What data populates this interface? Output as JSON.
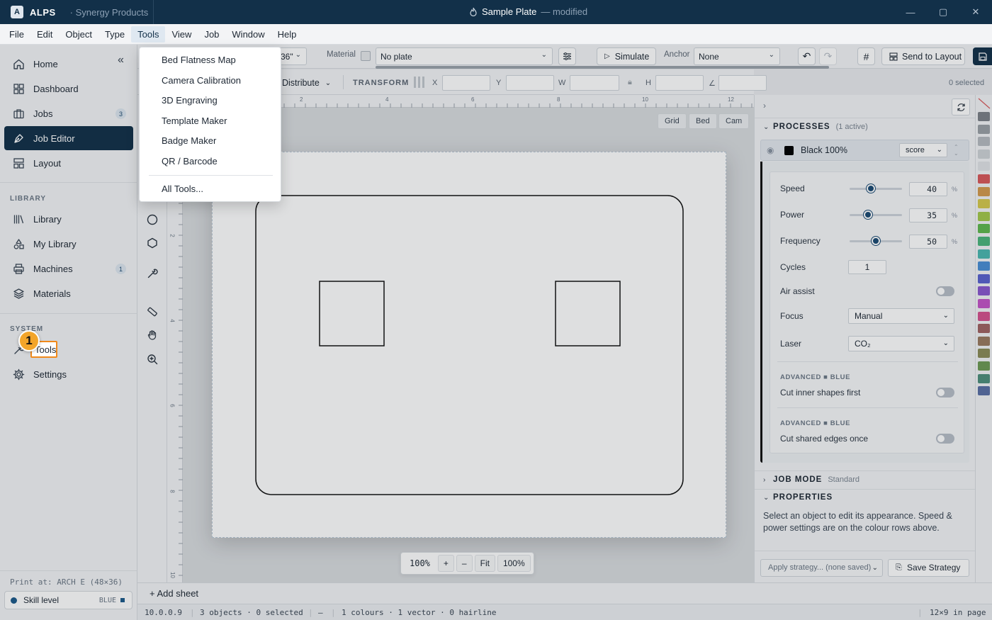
{
  "titlebar": {
    "logo_letter": "A",
    "app_name": "ALPS",
    "org": "· Synergy Products",
    "doc_title": "Sample Plate",
    "doc_status": "— modified"
  },
  "menubar": [
    "File",
    "Edit",
    "Object",
    "Type",
    "Tools",
    "View",
    "Job",
    "Window",
    "Help"
  ],
  "sidebar": {
    "nav": [
      {
        "label": "Home"
      },
      {
        "label": "Dashboard"
      },
      {
        "label": "Jobs",
        "badge": "3"
      },
      {
        "label": "Job Editor"
      },
      {
        "label": "Layout"
      }
    ],
    "library_heading": "LIBRARY",
    "library": [
      {
        "label": "Library"
      },
      {
        "label": "My Library"
      },
      {
        "label": "Machines",
        "badge": "1"
      },
      {
        "label": "Materials"
      }
    ],
    "system_heading": "SYSTEM",
    "system": [
      {
        "label": "Tools"
      },
      {
        "label": "Settings"
      }
    ],
    "print_at": "Print at: ARCH E (48×36)",
    "skill_label": "Skill level",
    "skill_value": "BLUE"
  },
  "toolbar": {
    "size_partial": "36\"",
    "material_label": "Material",
    "material_value": "No plate",
    "simulate": "Simulate",
    "anchor_label": "Anchor",
    "anchor_value": "None",
    "send_to_layout": "Send to Layout",
    "distribute": "Distribute",
    "transform_label": "TRANSFORM",
    "x_label": "X",
    "y_label": "Y",
    "w_label": "W",
    "h_label": "H",
    "selected_count": "0 selected"
  },
  "tools_menu": {
    "items": [
      "Bed Flatness Map",
      "Camera Calibration",
      "3D Engraving",
      "Template Maker",
      "Badge Maker",
      "QR / Barcode"
    ],
    "all_tools": "All Tools..."
  },
  "canvas": {
    "view_toggles": [
      "Grid",
      "Bed",
      "Cam"
    ],
    "ruler_top": [
      "2",
      "4",
      "6",
      "8",
      "10",
      "12"
    ],
    "ruler_left": [
      "2",
      "4",
      "6",
      "8",
      "10"
    ],
    "zoom": {
      "value": "100%",
      "plus": "+",
      "minus": "–",
      "fit": "Fit",
      "actual": "100%"
    }
  },
  "processes": {
    "title": "PROCESSES",
    "subtitle": "(1 active)",
    "row_name": "Black 100%",
    "row_color": "#000000",
    "mode": "score",
    "speed_label": "Speed",
    "speed_value": "40",
    "speed_fraction": 0.4,
    "power_label": "Power",
    "power_value": "35",
    "power_fraction": 0.35,
    "frequency_label": "Frequency",
    "frequency_value": "50",
    "frequency_fraction": 0.5,
    "percent": "%",
    "cycles_label": "Cycles",
    "cycles_value": "1",
    "air_assist_label": "Air assist",
    "focus_label": "Focus",
    "focus_value": "Manual",
    "laser_label": "Laser",
    "laser_value": "CO₂",
    "adv1_heading": "ADVANCED ■ BLUE",
    "adv1_label": "Cut inner shapes first",
    "adv2_heading": "ADVANCED ■ BLUE",
    "adv2_label": "Cut shared edges once"
  },
  "job_mode": {
    "title": "JOB MODE",
    "value": "Standard"
  },
  "properties": {
    "title": "PROPERTIES",
    "hint": "Select an object to edit its appearance. Speed & power settings are on the colour rows above."
  },
  "strategy": {
    "apply_placeholder": "Apply strategy... (none saved)",
    "save": "Save Strategy"
  },
  "palette": [
    "#7c8188",
    "#9aa0a6",
    "#b6bbc0",
    "#cfd3d7",
    "#e1e4e7",
    "#d9585a",
    "#d49a4d",
    "#d6c94c",
    "#a4c94b",
    "#5fb84f",
    "#4bb57c",
    "#4bb7b0",
    "#4a8fd6",
    "#5a62cf",
    "#8a58cf",
    "#c454c7",
    "#d5528f",
    "#a06262",
    "#9a7a60",
    "#8b8b58",
    "#6e9a54",
    "#4f8f7c",
    "#5a6fa5"
  ],
  "sheetbar": {
    "add_sheet": "+ Add sheet"
  },
  "status": {
    "version": "10.0.0.9",
    "objects": "3 objects · 0 selected",
    "dash": "—",
    "counts": "1 colours · 1 vector · 0 hairline",
    "page": "12×9 in page"
  },
  "annotation": {
    "marker": "1"
  }
}
